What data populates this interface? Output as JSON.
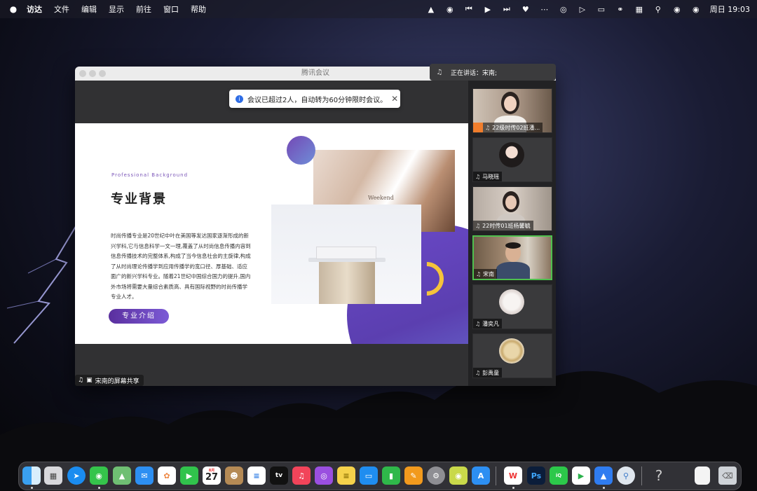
{
  "menubar": {
    "app_name": "访达",
    "items": [
      "文件",
      "编辑",
      "显示",
      "前往",
      "窗口",
      "帮助"
    ],
    "clock": "周日 19:03"
  },
  "window": {
    "title": "腾讯会议",
    "speaking": "正在讲话：宋南;",
    "toast": "会议已超过2人，自动转为60分钟限时会议。",
    "share_label": "宋南的屏幕共享"
  },
  "slide": {
    "subtitle": "Professional Background",
    "heading": "专业背景",
    "body": "时尚传播专业是20世纪中叶在美国等发达国家逐渐形成的新兴学科,它与信息科学一文一理,覆盖了从时尚信息传播内容到信息传播技术的完整体系,构成了当今信息社会的主旋律,构成了从时尚理论传播学到应用传播学的宽口径、厚基础、适应面广的新兴学科专业。随着21世纪中国综合国力的提升,国内外市场将需要大量综合素质高、具有国际视野的时尚传播学专业人才。",
    "cta": "专业介绍",
    "photo_text": "Weekend"
  },
  "participants": [
    {
      "name": "22级时传02班潘...",
      "active": false
    },
    {
      "name": "马晓瑶",
      "active": false
    },
    {
      "name": "22时传01班杨馨毓",
      "active": false
    },
    {
      "name": "宋南",
      "active": true
    },
    {
      "name": "潘奕凡",
      "active": false
    },
    {
      "name": "彭禹童",
      "active": false
    }
  ],
  "dock": {
    "calendar_month": "8月",
    "calendar_day": "27",
    "tv_label": "tv",
    "help_glyph": "?",
    "apps": [
      "finder",
      "launchpad",
      "safari",
      "messages",
      "maps",
      "mail",
      "photos",
      "facetime",
      "calendar",
      "contacts",
      "reminders",
      "tv",
      "music",
      "podcasts",
      "notes",
      "keynote",
      "numbers",
      "pages",
      "system-preferences",
      "wechat",
      "app-store",
      "wps",
      "photoshop",
      "iqiyi",
      "video-player",
      "tencent-meeting",
      "preview",
      "help",
      "document",
      "trash"
    ]
  }
}
